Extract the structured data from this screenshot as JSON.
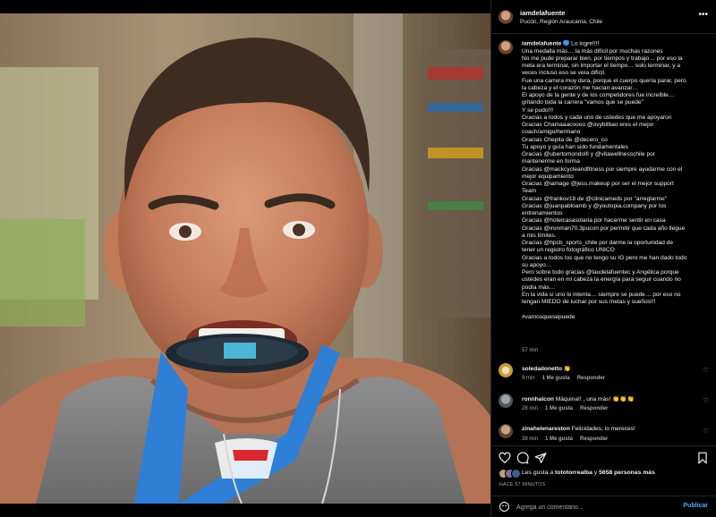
{
  "post": {
    "username": "iamdelafuente",
    "location": "Pucón, Región Araucanía, Chile"
  },
  "caption": {
    "username": "iamdelafuente",
    "first_line": " Lo logre!!!!",
    "lines": [
      "Una medalla más… la más difícil por muchas razones",
      "No me pude preparar bien, por tiempos y trabajo… por eso la",
      "meta era terminar, sin importar el tiempo… solo terminar, y a",
      "veces incluso eso se veía difícil.",
      "Fue una carrera muy dura, porque el cuerpo quería parar, pero",
      "la cabeza y el corazón me hacían avanzar…",
      "El apoyo de la gente y de los competidores fue increíble…",
      "gritando toda la carrera \"vamos que se puede\"",
      "Y se pudo!!!",
      "Gracias a todos y cada uno de ustedes que me apoyaron",
      "Gracias Chamaaacoooo @ovybilbao eres el mejor",
      "coach/amigo/hermano",
      "Gracias Chepita de @decero_co",
      "Tu apoyo y guía han sido fundamentales",
      "Gracias @ubertomondolfi y @vitawellnesschile por",
      "mantenerme en forma",
      "Gracias @mackcycleandfitness por siempre ayudarme con el",
      "mejor equipamiento",
      "Gracias @iamage @jess.makeup por ser el mejor support",
      "Team",
      "Gracias @frankov18 de @clinicameds por \"arreglarme\"",
      "Gracias @juanpabloamb y @youtopia.company por los",
      "entrenamientos",
      "Gracias @hotelcasasolaria por hacerme sentir en casa",
      "Gracias @ironman70.3pucon por permitir que cada año llegue",
      "a mis límites.",
      "Gracias @hpcb_sports_chile por darme la oportunidad de",
      "tener un registro fotográfico ÚNICO",
      "Gracias a todos los que no tengo su IG pero me han dado todo",
      "su apoyo…",
      "Pero sobre todo gracias @laudelafuentec y Angélica porque",
      "ustedes eran en mi cabeza la energía para seguir cuando no",
      "podía más…",
      "En la vida si uno lo intenta… siempre se puede… por eso no",
      "tengan MIEDO de luchar por sus metas y sueños!!!",
      "",
      "#vamosquesepuede"
    ],
    "time": "57 min"
  },
  "comments": [
    {
      "username": "soledadonetto",
      "text": " 👏",
      "time": "9 min",
      "likes": "1 Me gusta",
      "reply": "Responder"
    },
    {
      "username": "ronnhalcon",
      "text": " Máquina!! , una más! 👏👏👏",
      "time": "28 min",
      "likes": "1 Me gusta",
      "reply": "Responder"
    },
    {
      "username": "zinahelenareston",
      "text": " Felicidades, lo mereces!",
      "time": "38 min",
      "likes": "1 Me gusta",
      "reply": "Responder"
    }
  ],
  "likes": {
    "prefix": "Les gusta a ",
    "user": "tototorrealba",
    "middle": " y ",
    "count": "5658 personas más"
  },
  "ago": "HACE 57 MINUTOS",
  "add_comment": {
    "placeholder": "Agrega un comentario...",
    "publish": "Publicar"
  },
  "icons": {
    "more": "more-icon",
    "like": "heart-icon",
    "comment": "comment-icon",
    "share": "share-icon",
    "save": "bookmark-icon",
    "emoji": "emoji-icon"
  },
  "colors": {
    "background": "#000000",
    "text": "#f5f5f5",
    "muted": "#a8a8a8",
    "link": "#5fa8f5",
    "verified": "#3897f0",
    "lanyard": "#2f7fd6"
  }
}
